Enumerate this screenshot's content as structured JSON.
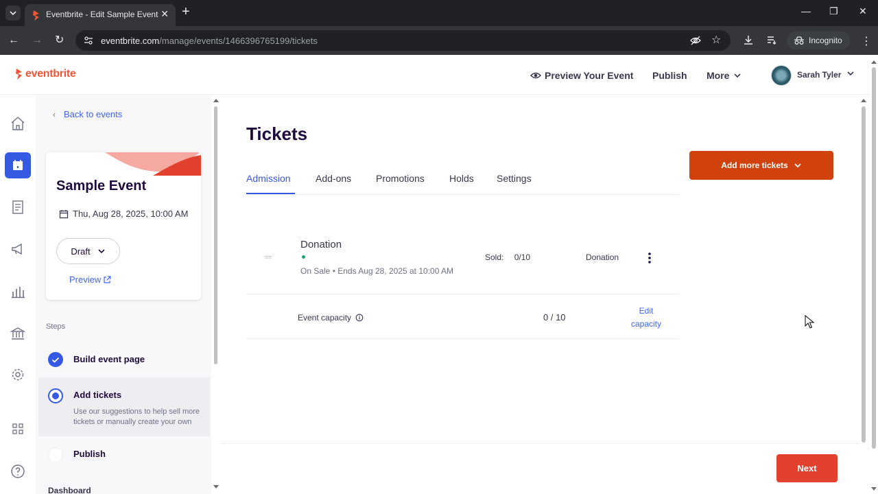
{
  "browser": {
    "tab_title": "Eventbrite - Edit Sample Event",
    "url_host": "eventbrite.com",
    "url_path": "/manage/events/1466396765199/tickets",
    "incognito_label": "Incognito"
  },
  "header": {
    "logo": "eventbrite",
    "preview_label": "Preview Your Event",
    "publish_label": "Publish",
    "more_label": "More",
    "user_name": "Sarah Tyler"
  },
  "sidebar": {
    "back_label": "Back to events",
    "event_name": "Sample Event",
    "event_date": "Thu, Aug 28, 2025, 10:00 AM",
    "status_label": "Draft",
    "preview_label": "Preview",
    "steps_label": "Steps",
    "steps": [
      {
        "title": "Build event page",
        "state": "done"
      },
      {
        "title": "Add tickets",
        "state": "current",
        "description": "Use our suggestions to help sell more tickets or manually create your own"
      },
      {
        "title": "Publish",
        "state": "todo"
      }
    ],
    "dashboard_label": "Dashboard"
  },
  "main": {
    "title": "Tickets",
    "tabs": [
      "Admission",
      "Add-ons",
      "Promotions",
      "Holds",
      "Settings"
    ],
    "active_tab": "Admission",
    "add_button": "Add more tickets",
    "ticket": {
      "name": "Donation",
      "status": "On Sale",
      "ends": "Ends Aug 28, 2025 at 10:00 AM",
      "sold_label": "Sold:",
      "sold_value": "0/10",
      "type": "Donation"
    },
    "capacity": {
      "label": "Event capacity",
      "value": "0 / 10",
      "edit_line1": "Edit",
      "edit_line2": "capacity"
    },
    "next_button": "Next"
  },
  "colors": {
    "brand_orange": "#f05537",
    "primary_blue": "#3659e3",
    "cta_orange": "#d1410c"
  }
}
